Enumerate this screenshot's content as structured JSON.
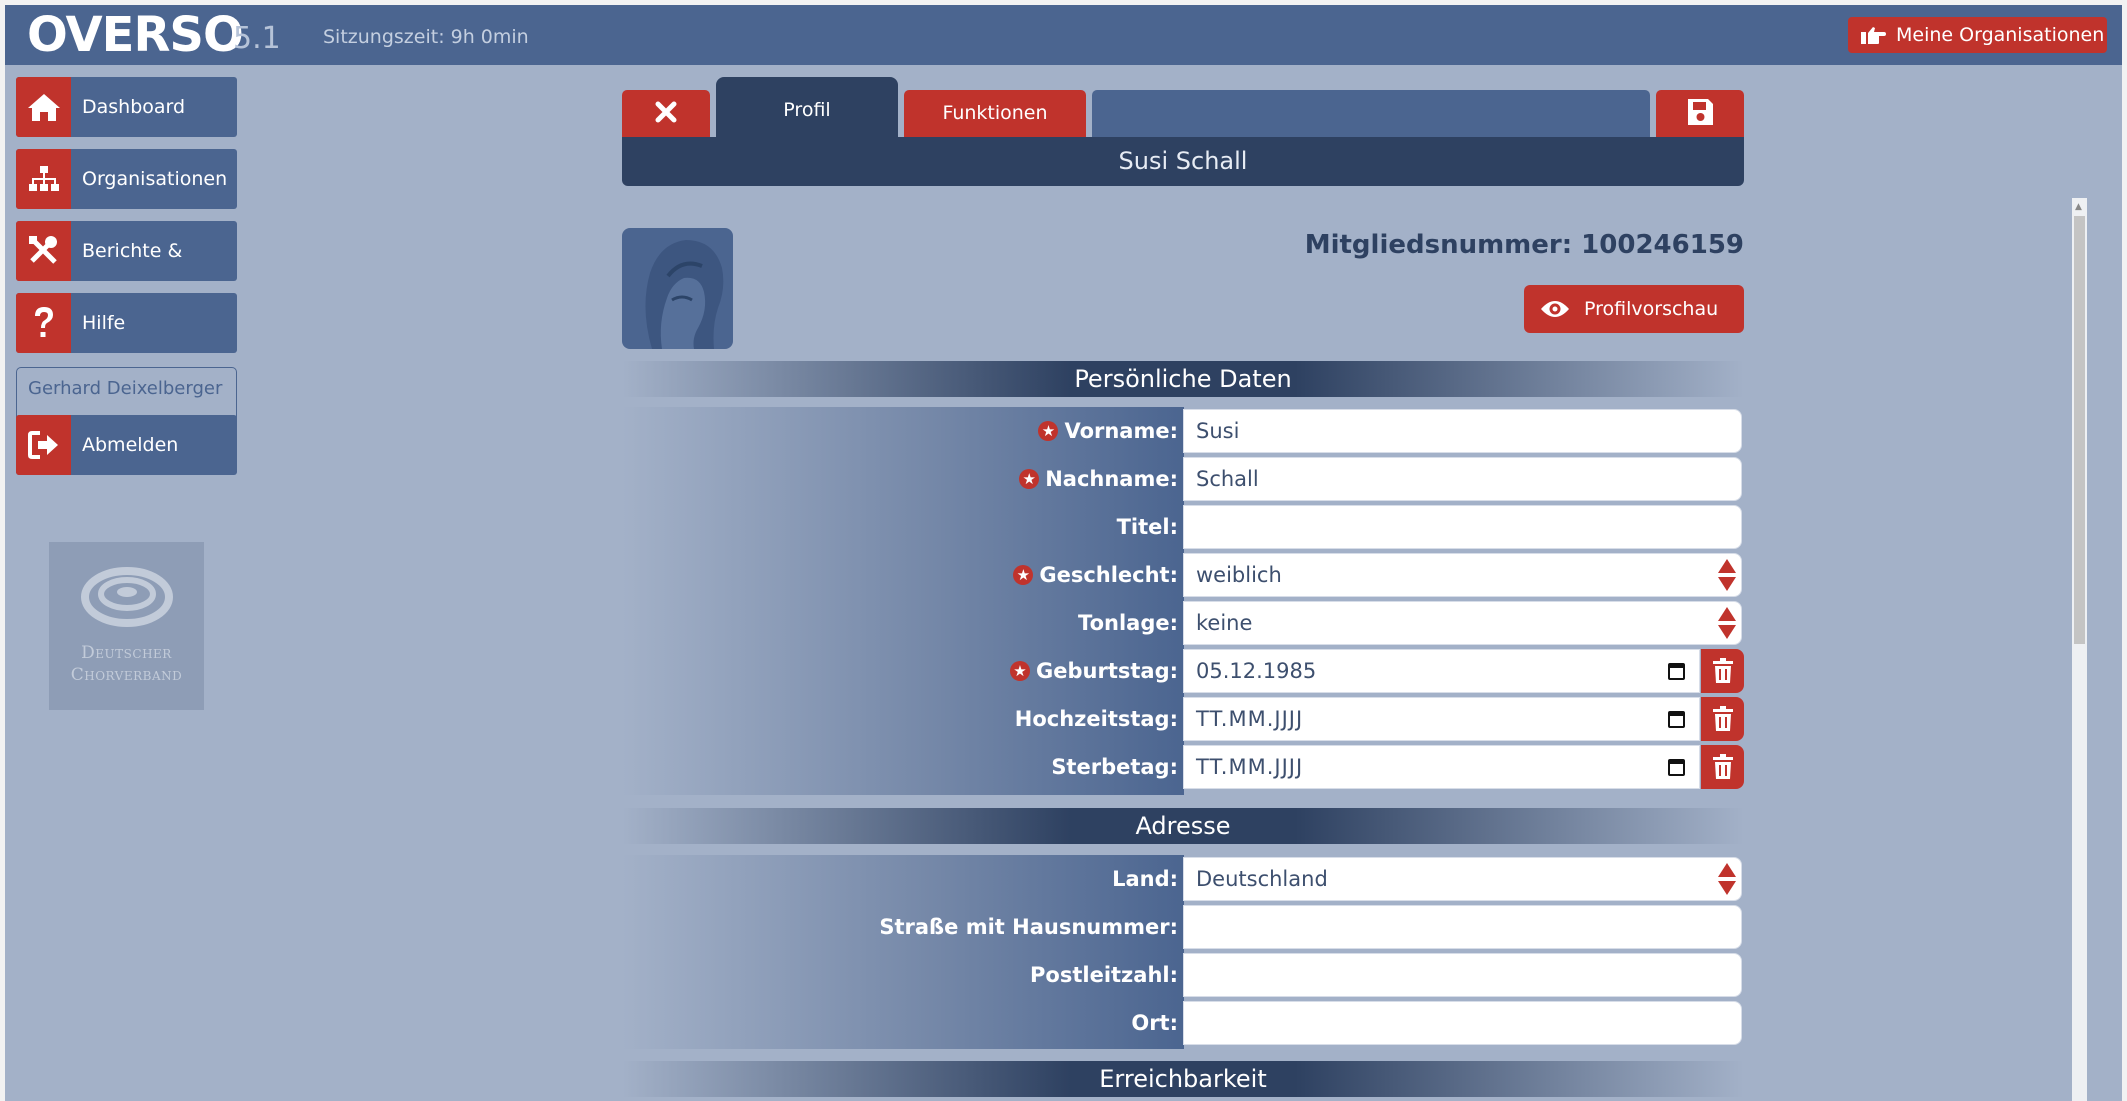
{
  "app": {
    "logo": "OVERSO",
    "version": "5.1",
    "session": "Sitzungszeit: 9h 0min",
    "org_button": "Meine Organisationen"
  },
  "sidebar": {
    "items": [
      {
        "label": "Dashboard",
        "icon": "home-icon"
      },
      {
        "label": "Organisationen",
        "icon": "sitemap-icon"
      },
      {
        "label": "Berichte & mehr",
        "icon": "tools-icon"
      },
      {
        "label": "Hilfe",
        "icon": "question-icon"
      }
    ],
    "user_name": "Gerhard Deixelberger",
    "logout": "Abmelden",
    "partner_logo": {
      "line1": "Deutscher",
      "line2": "Chorverband"
    }
  },
  "tabs": {
    "profil": "Profil",
    "funktionen": "Funktionen"
  },
  "person": {
    "name": "Susi Schall",
    "member_number": "Mitgliedsnummer: 100246159",
    "preview_button": "Profilvorschau"
  },
  "sections": {
    "personal": "Persönliche Daten",
    "address": "Adresse",
    "contact": "Erreichbarkeit"
  },
  "personal_fields": {
    "vorname": {
      "label": "Vorname:",
      "value": "Susi"
    },
    "nachname": {
      "label": "Nachname:",
      "value": "Schall"
    },
    "titel": {
      "label": "Titel:",
      "value": ""
    },
    "geschlecht": {
      "label": "Geschlecht:",
      "value": "weiblich"
    },
    "tonlage": {
      "label": "Tonlage:",
      "value": "keine"
    },
    "geburtstag": {
      "label": "Geburtstag:",
      "value": "05.12.1985"
    },
    "hochzeitstag": {
      "label": "Hochzeitstag:",
      "value": "TT.MM.JJJJ"
    },
    "sterbetag": {
      "label": "Sterbetag:",
      "value": "TT.MM.JJJJ"
    }
  },
  "address_fields": {
    "land": {
      "label": "Land:",
      "value": "Deutschland"
    },
    "strasse": {
      "label": "Straße mit Hausnummer:",
      "value": ""
    },
    "plz": {
      "label": "Postleitzahl:",
      "value": ""
    },
    "ort": {
      "label": "Ort:",
      "value": ""
    }
  },
  "colors": {
    "header_blue": "#4b6590",
    "dark_blue": "#2e4161",
    "accent_red": "#c0332c",
    "page_bg": "#a3b1c8"
  }
}
